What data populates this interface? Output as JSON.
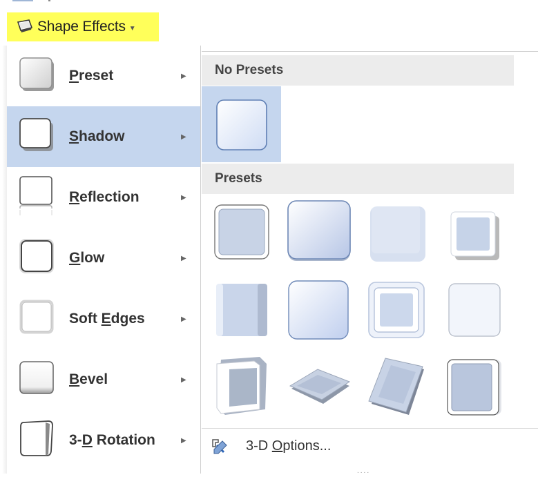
{
  "ribbon": {
    "label": "Shape Effects",
    "icon": "shape-effects-icon",
    "highlight_color": "#ffff5a"
  },
  "menu": {
    "items": [
      {
        "id": "preset",
        "pre": "",
        "ul": "P",
        "post": "reset",
        "icon": "preset-icon"
      },
      {
        "id": "shadow",
        "pre": "",
        "ul": "S",
        "post": "hadow",
        "icon": "shadow-icon",
        "selected": true
      },
      {
        "id": "reflection",
        "pre": "",
        "ul": "R",
        "post": "eflection",
        "icon": "reflection-icon"
      },
      {
        "id": "glow",
        "pre": "",
        "ul": "G",
        "post": "low",
        "icon": "glow-icon"
      },
      {
        "id": "soft-edges",
        "pre": "Soft ",
        "ul": "E",
        "post": "dges",
        "icon": "soft-edges-icon"
      },
      {
        "id": "bevel",
        "pre": "",
        "ul": "B",
        "post": "evel",
        "icon": "bevel-icon"
      },
      {
        "id": "3d-rotation",
        "pre": "3-",
        "ul": "D",
        "post": " Rotation",
        "icon": "3d-rotation-icon"
      }
    ],
    "selected_color": "#c5d6ee"
  },
  "submenu": {
    "no_presets_heading": "No Presets",
    "presets_heading": "Presets",
    "footer": {
      "pre": "3-D ",
      "ul": "O",
      "post": "ptions...",
      "icon": "3d-options-icon"
    }
  }
}
